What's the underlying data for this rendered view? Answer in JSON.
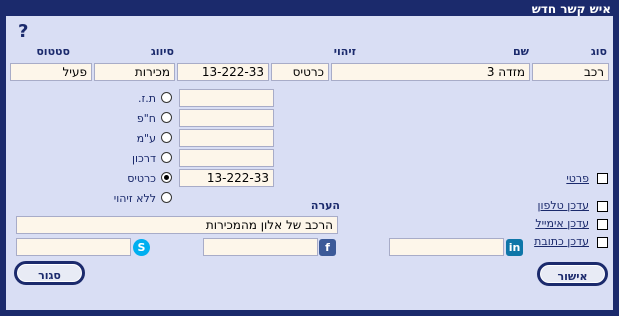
{
  "window": {
    "title": "איש קשר חדש",
    "help_label": "?"
  },
  "table": {
    "headers": {
      "type": "סוג",
      "name": "שם",
      "id": "זיהוי",
      "classification": "סיווג",
      "status": "סטטוס"
    },
    "row": {
      "type": "רכב",
      "name": "מזדה 3",
      "id_type": "כרטיס",
      "id_value": "13-222-33",
      "classification": "מכירות",
      "status": "פעיל"
    }
  },
  "id_options": [
    {
      "label": "ת.ז.",
      "value": "",
      "selected": false
    },
    {
      "label": "ח\"פ",
      "value": "",
      "selected": false
    },
    {
      "label": "ע\"מ",
      "value": "",
      "selected": false
    },
    {
      "label": "דרכון",
      "value": "",
      "selected": false
    },
    {
      "label": "כרטיס",
      "value": "13-222-33",
      "selected": true
    },
    {
      "label": "ללא זיהוי",
      "value": "",
      "selected": false
    }
  ],
  "checkboxes": {
    "private": "פרטי",
    "update_phone": "עדכן טלפון",
    "update_email": "עדכן אימייל",
    "update_address": "עדכן כתובת"
  },
  "note": {
    "label": "הערה",
    "value": "הרכב של אלון מהמכירות"
  },
  "social": {
    "linkedin_value": "",
    "facebook_value": "",
    "skype_value": ""
  },
  "buttons": {
    "confirm": "אישור",
    "close": "סגור"
  },
  "colors": {
    "frame": "#1b2a6c",
    "panel": "#d9def4",
    "field": "#fdf6ea",
    "linkedin": "#0e76a8",
    "facebook": "#3b5998",
    "skype": "#00aff0"
  }
}
